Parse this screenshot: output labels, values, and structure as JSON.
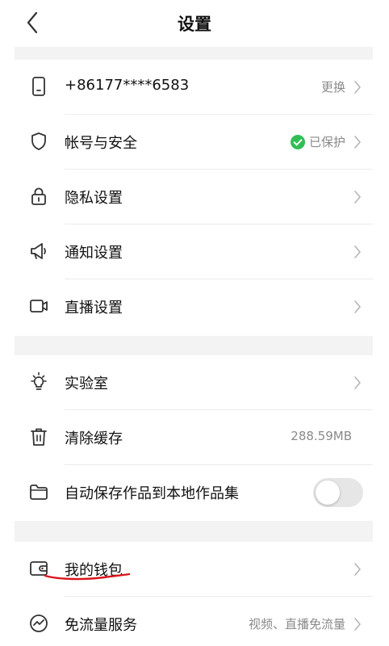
{
  "header": {
    "title": "设置",
    "back_icon": "chevron-left-icon"
  },
  "groups": [
    {
      "rows": [
        {
          "icon": "phone-icon",
          "label": "+86177****6583",
          "right_text": "更换",
          "chevron": true
        },
        {
          "icon": "shield-icon",
          "label": "帐号与安全",
          "right_text": "已保护",
          "status_icon": "check-circle-icon",
          "status_color": "#2fbf55",
          "chevron": true
        },
        {
          "icon": "lock-icon",
          "label": "隐私设置",
          "chevron": true
        },
        {
          "icon": "megaphone-icon",
          "label": "通知设置",
          "chevron": true
        },
        {
          "icon": "video-camera-icon",
          "label": "直播设置",
          "chevron": true
        }
      ]
    },
    {
      "rows": [
        {
          "icon": "lightbulb-icon",
          "label": "实验室",
          "chevron": true
        },
        {
          "icon": "trash-icon",
          "label": "清除缓存",
          "right_text": "288.59MB",
          "chevron": false
        },
        {
          "icon": "folder-icon",
          "label": "自动保存作品到本地作品集",
          "toggle": false
        }
      ]
    },
    {
      "rows": [
        {
          "icon": "wallet-icon",
          "label": "我的钱包",
          "chevron": true
        },
        {
          "icon": "trend-icon",
          "label": "免流量服务",
          "right_text": "视频、直播免流量",
          "chevron": true
        }
      ]
    }
  ],
  "annotation": {
    "underline_color": "#d9141a"
  },
  "colors": {
    "section_gap": "#f3f3f3",
    "divider": "#ececec",
    "secondary_text": "#8a8a8a",
    "accent_green": "#2fbf55"
  }
}
